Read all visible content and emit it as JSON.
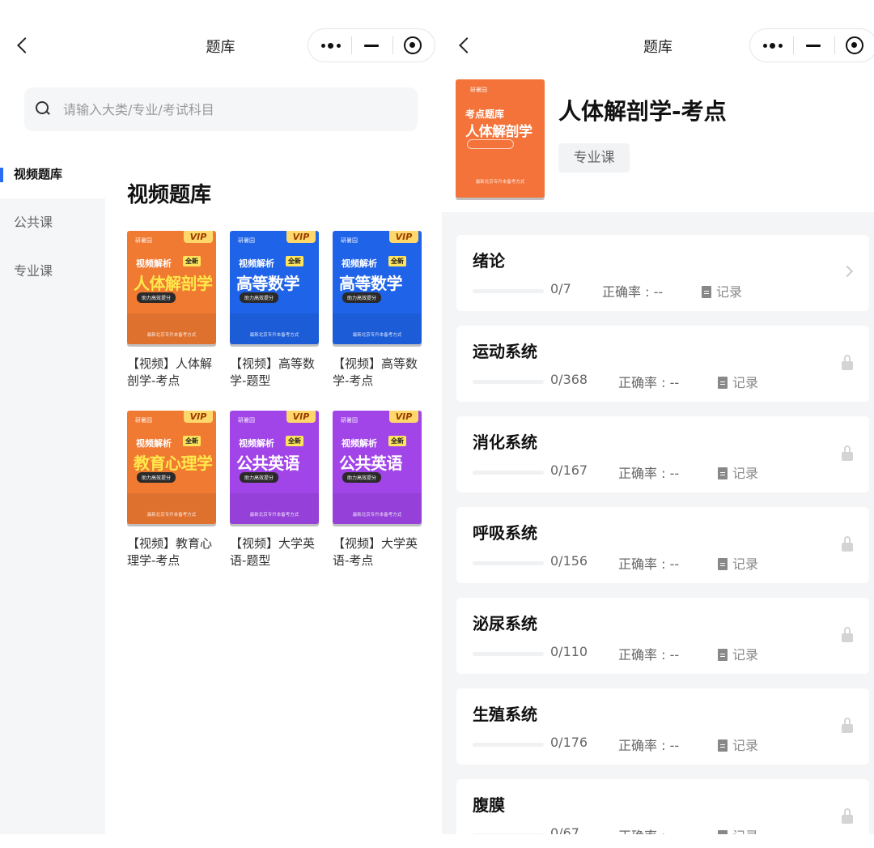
{
  "left": {
    "nav": {
      "title": "题库"
    },
    "search": {
      "placeholder": "请输入大类/专业/考试科目"
    },
    "sidebar": {
      "items": [
        {
          "label": "视频题库",
          "active": true
        },
        {
          "label": "公共课",
          "active": false
        },
        {
          "label": "专业课",
          "active": false
        }
      ]
    },
    "section_title": "视频题库",
    "books": [
      {
        "label": "【视频】人体解剖学-考点",
        "cover": {
          "theme": "orange",
          "brand": "研暑园",
          "vip": "VIP",
          "sub": "视频解析",
          "tag": "全新",
          "big": "人体解剖学",
          "pill": "助力高效提分",
          "foot": "最新北京专升本备考方式"
        }
      },
      {
        "label": "【视频】高等数学-题型",
        "cover": {
          "theme": "blue",
          "brand": "研暑园",
          "vip": "VIP",
          "sub": "视频解析",
          "tag": "全新",
          "big": "高等数学",
          "pill": "助力高效提分",
          "foot": "最新北京专升本备考方式"
        }
      },
      {
        "label": "【视频】高等数学-考点",
        "cover": {
          "theme": "blue",
          "brand": "研暑园",
          "vip": "VIP",
          "sub": "视频解析",
          "tag": "全新",
          "big": "高等数学",
          "pill": "助力高效提分",
          "foot": "最新北京专升本备考方式"
        }
      },
      {
        "label": "【视频】教育心理学-考点",
        "cover": {
          "theme": "orange",
          "brand": "研暑园",
          "vip": "VIP",
          "sub": "视频解析",
          "tag": "全新",
          "big": "教育心理学",
          "pill": "助力高效提分",
          "foot": "最新北京专升本备考方式"
        }
      },
      {
        "label": "【视频】大学英语-题型",
        "cover": {
          "theme": "purple",
          "brand": "研暑园",
          "vip": "VIP",
          "sub": "视频解析",
          "tag": "全新",
          "big": "公共英语",
          "pill": "助力高效提分",
          "foot": "最新北京专升本备考方式"
        }
      },
      {
        "label": "【视频】大学英语-考点",
        "cover": {
          "theme": "purple",
          "brand": "研暑园",
          "vip": "VIP",
          "sub": "视频解析",
          "tag": "全新",
          "big": "公共英语",
          "pill": "助力高效提分",
          "foot": "最新北京专升本备考方式"
        }
      }
    ]
  },
  "right": {
    "nav": {
      "title": "题库"
    },
    "course": {
      "cover": {
        "brand": "研暑园",
        "line1": "考点题库",
        "line2": "人体解剖学",
        "foot": "最新北京专升本备考方式"
      },
      "title": "人体解剖学-考点",
      "tag": "专业课"
    },
    "accuracy_label": "正确率 : --",
    "record_label": "记录",
    "chapters": [
      {
        "title": "绪论",
        "done": 0,
        "total": 7,
        "progress": "0/7",
        "locked": false
      },
      {
        "title": "运动系统",
        "done": 0,
        "total": 368,
        "progress": "0/368",
        "locked": true
      },
      {
        "title": "消化系统",
        "done": 0,
        "total": 167,
        "progress": "0/167",
        "locked": true
      },
      {
        "title": "呼吸系统",
        "done": 0,
        "total": 156,
        "progress": "0/156",
        "locked": true
      },
      {
        "title": "泌尿系统",
        "done": 0,
        "total": 110,
        "progress": "0/110",
        "locked": true
      },
      {
        "title": "生殖系统",
        "done": 0,
        "total": 176,
        "progress": "0/176",
        "locked": true
      },
      {
        "title": "腹膜",
        "done": 0,
        "total": 67,
        "progress": "0/67",
        "locked": true
      }
    ]
  },
  "colors": {
    "accent": "#2a6df4",
    "orange": "#f07a32",
    "blue": "#1f63e8",
    "purple": "#a145e9",
    "page_bg": "#f4f5f7"
  }
}
